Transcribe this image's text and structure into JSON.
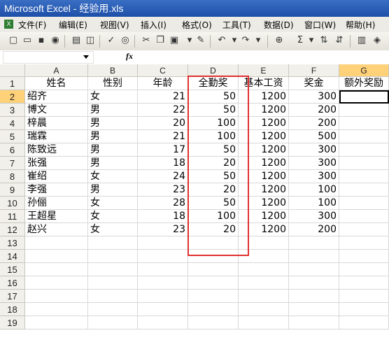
{
  "window": {
    "title": "Microsoft Excel - 经验用.xls"
  },
  "menu": [
    "文件(F)",
    "编辑(E)",
    "视图(V)",
    "插入(I)",
    "格式(O)",
    "工具(T)",
    "数据(D)",
    "窗口(W)",
    "帮助(H)"
  ],
  "toolbar_icons": [
    "new-icon",
    "open-icon",
    "save-icon",
    "permission-icon",
    "print-icon",
    "print-preview-icon",
    "spelling-icon",
    "research-icon",
    "cut-icon",
    "copy-icon",
    "paste-icon",
    "format-painter-icon",
    "undo-icon",
    "redo-icon",
    "hyperlink-icon",
    "autosum-icon",
    "sort-ascending-icon",
    "sort-descending-icon",
    "chart-wizard-icon",
    "drawing-icon"
  ],
  "formula_bar": {
    "fx_label": "fx",
    "namebox_value": "",
    "formula_value": ""
  },
  "columns": [
    "A",
    "B",
    "C",
    "D",
    "E",
    "F",
    "G"
  ],
  "rows": [
    "1",
    "2",
    "3",
    "4",
    "5",
    "6",
    "7",
    "8",
    "9",
    "10",
    "11",
    "12",
    "13",
    "14",
    "15",
    "16",
    "17",
    "18",
    "19"
  ],
  "headers": [
    "姓名",
    "性别",
    "年龄",
    "全勤奖",
    "基本工资",
    "奖金",
    "额外奖励"
  ],
  "records": [
    [
      "绍齐",
      "女",
      "21",
      "50",
      "1200",
      "300"
    ],
    [
      "博文",
      "男",
      "22",
      "50",
      "1200",
      "200"
    ],
    [
      "梓晨",
      "男",
      "20",
      "100",
      "1200",
      "200"
    ],
    [
      "瑞霖",
      "男",
      "21",
      "100",
      "1200",
      "500"
    ],
    [
      "陈致远",
      "男",
      "17",
      "50",
      "1200",
      "300"
    ],
    [
      "张强",
      "男",
      "18",
      "20",
      "1200",
      "300"
    ],
    [
      "崔绍",
      "女",
      "24",
      "50",
      "1200",
      "300"
    ],
    [
      "李强",
      "男",
      "23",
      "20",
      "1200",
      "100"
    ],
    [
      "孙俪",
      "女",
      "28",
      "50",
      "1200",
      "100"
    ],
    [
      "王超星",
      "女",
      "18",
      "100",
      "1200",
      "300"
    ],
    [
      "赵兴",
      "女",
      "23",
      "20",
      "1200",
      "200"
    ]
  ],
  "selection": {
    "column": "G",
    "row": "2"
  },
  "highlight_color": "#e03030"
}
